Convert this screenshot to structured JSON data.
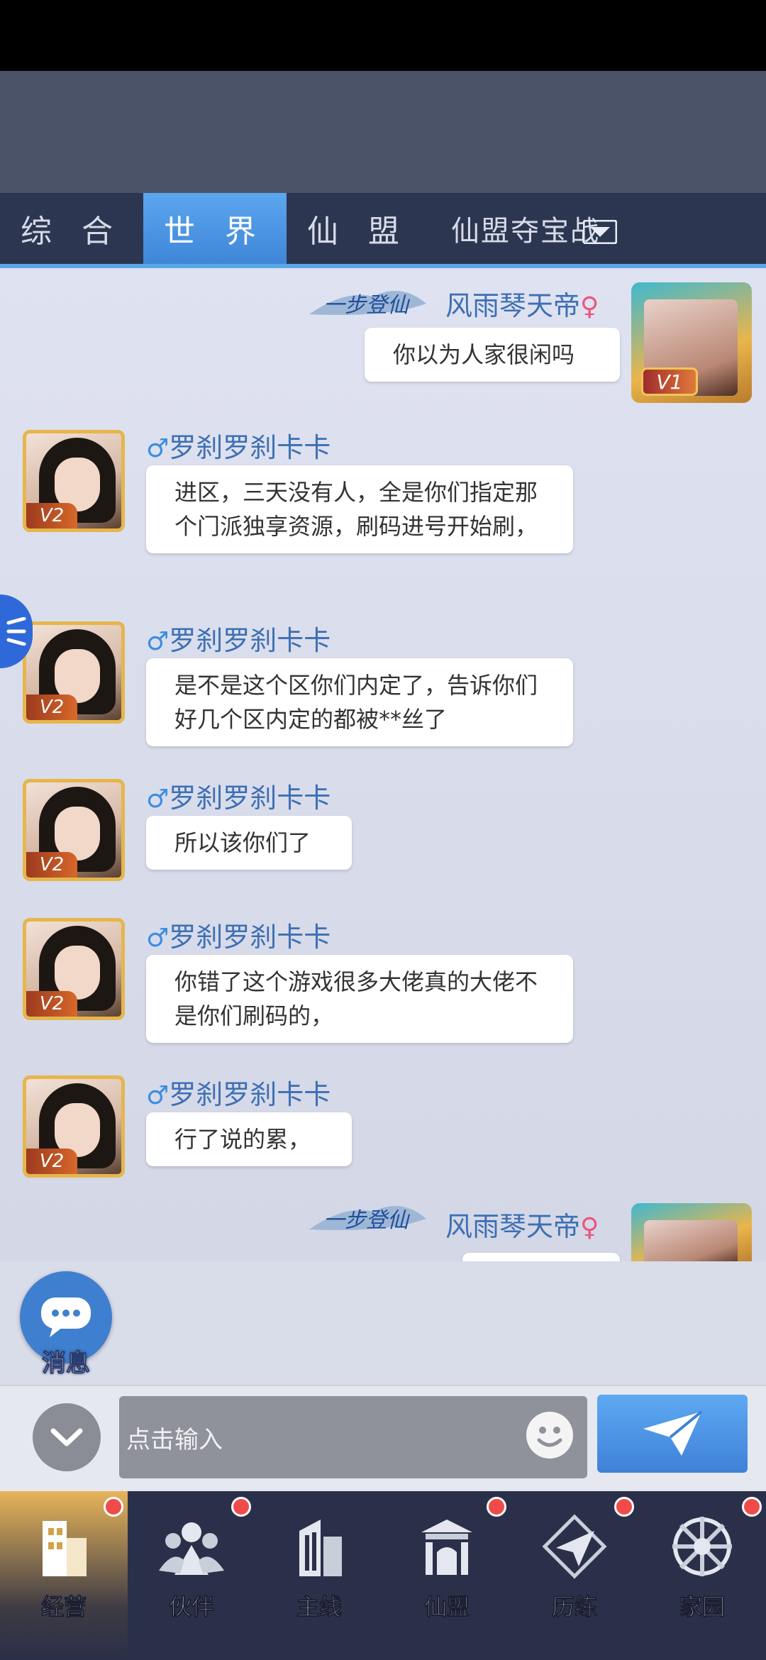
{
  "tabs": [
    {
      "label": "综 合"
    },
    {
      "label": "世 界"
    },
    {
      "label": "仙 盟"
    },
    {
      "label": "仙盟夺宝战"
    }
  ],
  "messages": [
    {
      "name": "风雨琴天帝",
      "gender": "♀",
      "vip": "V1",
      "text": "你以为人家很闲吗"
    },
    {
      "name": "罗刹罗刹卡卡",
      "gender": "♂",
      "vip": "V2",
      "text": "进区，三天没有人，全是你们指定那个门派独享资源，刷码进号开始刷，"
    },
    {
      "name": "罗刹罗刹卡卡",
      "gender": "♂",
      "vip": "V2",
      "text": "是不是这个区你们内定了，告诉你们好几个区内定的都被**丝了"
    },
    {
      "name": "罗刹罗刹卡卡",
      "gender": "♂",
      "vip": "V2",
      "text": "所以该你们了"
    },
    {
      "name": "罗刹罗刹卡卡",
      "gender": "♂",
      "vip": "V2",
      "text": "你错了这个游戏很多大佬真的大佬不是你们刷码的，"
    },
    {
      "name": "罗刹罗刹卡卡",
      "gender": "♂",
      "vip": "V2",
      "text": "行了说的累，"
    },
    {
      "name": "风雨琴天帝",
      "gender": "♀",
      "vip": "",
      "text": ""
    }
  ],
  "message_button": {
    "label": "消息"
  },
  "input": {
    "placeholder": "点击输入"
  },
  "nav": [
    {
      "label": "经营"
    },
    {
      "label": "伙伴"
    },
    {
      "label": "主线"
    },
    {
      "label": "仙盟"
    },
    {
      "label": "历练"
    },
    {
      "label": "家园"
    }
  ],
  "colors": {
    "accent": "#4a93e6",
    "name": "#3d6fb3",
    "male": "#3c8de0",
    "female": "#e8567e",
    "badge": "#f04b4b"
  }
}
